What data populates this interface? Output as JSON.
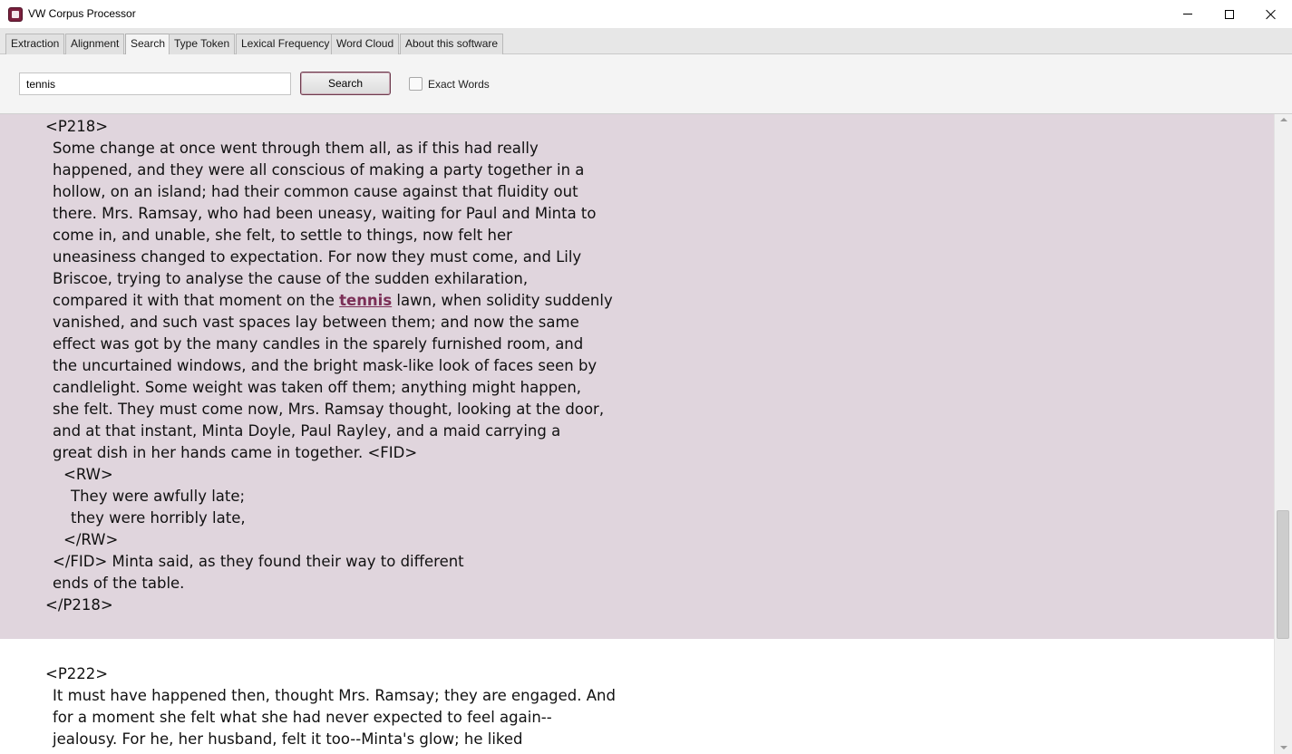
{
  "window": {
    "title": "VW Corpus Processor"
  },
  "tabs": [
    {
      "label": "Extraction",
      "active": false
    },
    {
      "label": "Alignment",
      "active": false
    },
    {
      "label": "Search",
      "active": true
    },
    {
      "label": "Type Token",
      "active": false
    },
    {
      "label": "Lexical Frequency",
      "active": false
    },
    {
      "label": "Word Cloud",
      "active": false
    },
    {
      "label": "About this software",
      "active": false
    }
  ],
  "search": {
    "query": "tennis",
    "button_label": "Search",
    "exact_words_label": "Exact Words",
    "exact_words_checked": false
  },
  "colors": {
    "highlight_bg": "#e0d5dd",
    "hit_text": "#7b2f57",
    "app_icon": "#7a1f3d"
  },
  "scroll": {
    "position_fraction": 0.79,
    "visible_fraction": 0.21
  },
  "results": [
    {
      "highlighted": true,
      "lines": [
        {
          "indent": 0,
          "text": "<P218>"
        },
        {
          "indent": 1,
          "text": "Some change at once went through them all, as if this had really"
        },
        {
          "indent": 1,
          "text": "happened, and they were all conscious of making a party together in a"
        },
        {
          "indent": 1,
          "text": "hollow, on an island; had their common cause against that fluidity out"
        },
        {
          "indent": 1,
          "text": "there. Mrs. Ramsay, who had been uneasy, waiting for Paul and Minta to"
        },
        {
          "indent": 1,
          "text": "come in, and unable, she felt, to settle to things, now felt her"
        },
        {
          "indent": 1,
          "text": "uneasiness changed to expectation. For now they must come, and Lily"
        },
        {
          "indent": 1,
          "text": "Briscoe, trying to analyse the cause of the sudden exhilaration,"
        },
        {
          "indent": 1,
          "text": "compared it with that moment on the ",
          "hit": "tennis",
          "after": " lawn, when solidity suddenly"
        },
        {
          "indent": 1,
          "text": "vanished, and such vast spaces lay between them; and now the same"
        },
        {
          "indent": 1,
          "text": "effect was got by the many candles in the sparely furnished room, and"
        },
        {
          "indent": 1,
          "text": "the uncurtained windows, and the bright mask-like look of faces seen by"
        },
        {
          "indent": 1,
          "text": "candlelight. Some weight was taken off them; anything might happen,"
        },
        {
          "indent": 1,
          "text": "she felt. They must come now, Mrs. Ramsay thought, looking at the door,"
        },
        {
          "indent": 1,
          "text": "and at that instant, Minta Doyle, Paul Rayley, and a maid carrying a"
        },
        {
          "indent": 1,
          "text": "great dish in her hands came in together. <FID>"
        },
        {
          "indent": 2,
          "text": "<RW>"
        },
        {
          "indent": 3,
          "text": "They were awfully late;"
        },
        {
          "indent": 3,
          "text": "they were horribly late,"
        },
        {
          "indent": 2,
          "text": "</RW>"
        },
        {
          "indent": 1,
          "text": "</FID> Minta said, as they found their way to different"
        },
        {
          "indent": 1,
          "text": "ends of the table."
        },
        {
          "indent": 0,
          "text": "</P218>"
        }
      ]
    },
    {
      "highlighted": false,
      "lines": [
        {
          "indent": 0,
          "text": "<P222>"
        },
        {
          "indent": 1,
          "text": "It must have happened then, thought Mrs. Ramsay; they are engaged. And"
        },
        {
          "indent": 1,
          "text": "for a moment she felt what she had never expected to feel again--"
        },
        {
          "indent": 1,
          "text": "jealousy. For he, her husband, felt it too--Minta's glow; he liked"
        }
      ]
    }
  ]
}
